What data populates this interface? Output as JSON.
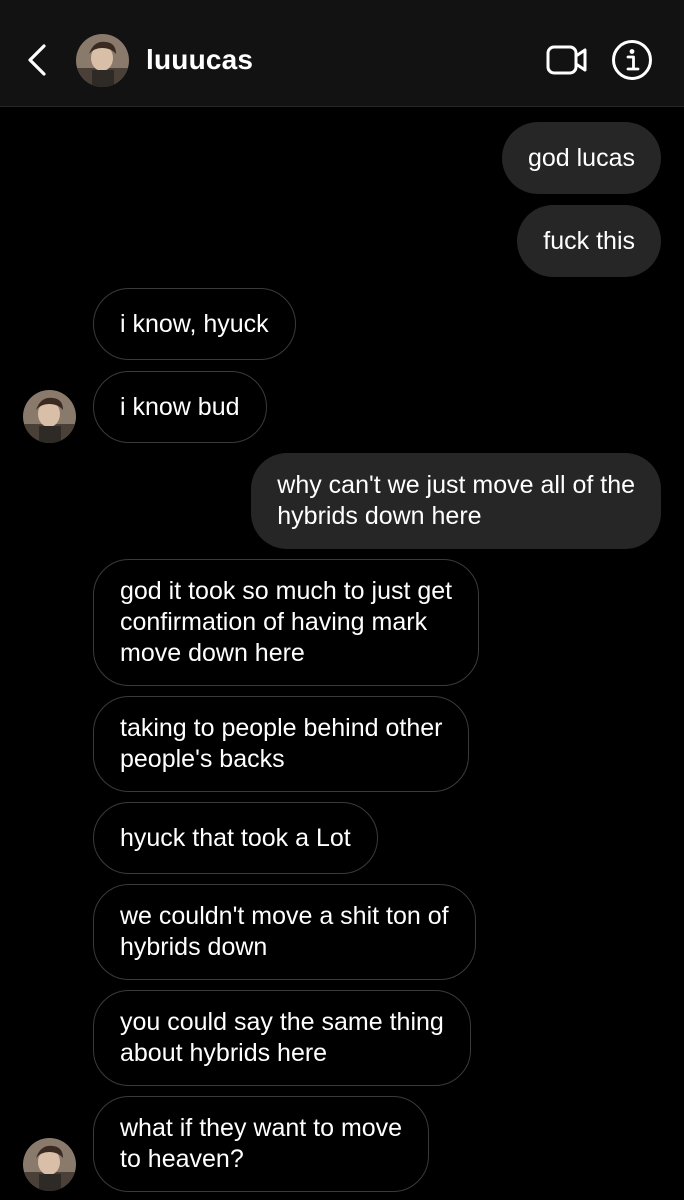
{
  "header": {
    "username": "luuucas",
    "back_icon": "chevron-left-icon",
    "video_icon": "video-camera-icon",
    "info_icon": "info-icon"
  },
  "colors": {
    "background": "#000000",
    "header_background": "#121212",
    "sent_bubble": "#262626",
    "received_border": "#3a3a3a",
    "text": "#ffffff"
  },
  "messages": [
    {
      "sender": "me",
      "lines": [
        "god lucas"
      ]
    },
    {
      "sender": "me",
      "lines": [
        "fuck this"
      ]
    },
    {
      "sender": "them",
      "lines": [
        "i know, hyuck"
      ]
    },
    {
      "sender": "them",
      "lines": [
        "i know bud"
      ]
    },
    {
      "sender": "me",
      "lines": [
        "why can't we just move all of the",
        "hybrids down here"
      ]
    },
    {
      "sender": "them",
      "lines": [
        "god it took so much to just get",
        "confirmation of having mark",
        "move down here"
      ]
    },
    {
      "sender": "them",
      "lines": [
        "taking to people behind other",
        "people's backs"
      ]
    },
    {
      "sender": "them",
      "lines": [
        "hyuck that took a Lot"
      ]
    },
    {
      "sender": "them",
      "lines": [
        "we couldn't move a shit ton of",
        "hybrids down"
      ]
    },
    {
      "sender": "them",
      "lines": [
        "you could say the same thing",
        "about hybrids here"
      ]
    },
    {
      "sender": "them",
      "lines": [
        "what if they want to move",
        "to heaven?"
      ]
    }
  ]
}
